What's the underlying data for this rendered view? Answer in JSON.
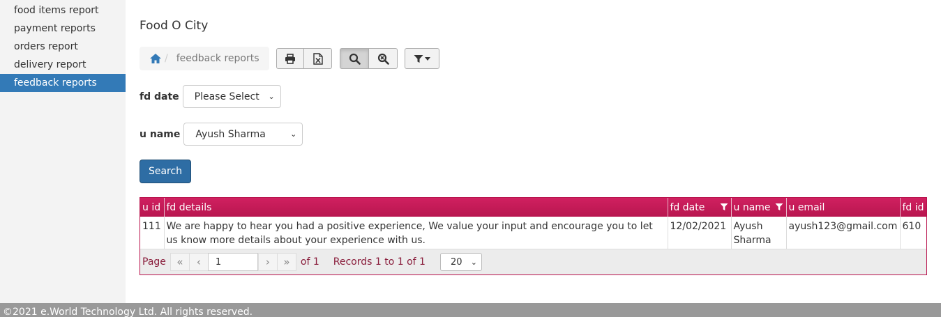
{
  "sidebar": {
    "items": [
      {
        "label": "food items report",
        "active": false
      },
      {
        "label": "payment reports",
        "active": false
      },
      {
        "label": "orders report",
        "active": false
      },
      {
        "label": "delivery report",
        "active": false
      },
      {
        "label": "feedback reports",
        "active": true
      }
    ]
  },
  "header": {
    "title": "Food O City"
  },
  "breadcrumb": {
    "home_icon": "home-icon",
    "separator": "/",
    "current": "feedback reports"
  },
  "toolbar": {
    "icons": [
      "print-icon",
      "excel-icon",
      "search-icon",
      "zoom-reset-icon",
      "filter-icon"
    ]
  },
  "filters": {
    "fd_date": {
      "label": "fd date",
      "value": "Please Select"
    },
    "u_name": {
      "label": "u name",
      "value": "Ayush Sharma"
    },
    "search_label": "Search"
  },
  "table": {
    "columns": [
      "u id",
      "fd details",
      "fd date",
      "u name",
      "u email",
      "fd id"
    ],
    "rows": [
      {
        "u_id": "111",
        "fd_details": "We are happy to hear you had a positive experience, We value your input and encourage you to let us know more details about your experience with us.",
        "fd_date": "12/02/2021",
        "u_name": "Ayush Sharma",
        "u_email": "ayush123@gmail.com",
        "fd_id": "610"
      }
    ]
  },
  "pager": {
    "page_label": "Page",
    "page_value": "1",
    "of_text": "of 1",
    "records_text": "Records 1 to 1 of 1",
    "page_size": "20"
  },
  "footer": {
    "text": "©2021 e.World Technology Ltd. All rights reserved."
  },
  "colors": {
    "accent": "#337ab7",
    "grid_header": "#c2185b",
    "footer": "#999999"
  }
}
